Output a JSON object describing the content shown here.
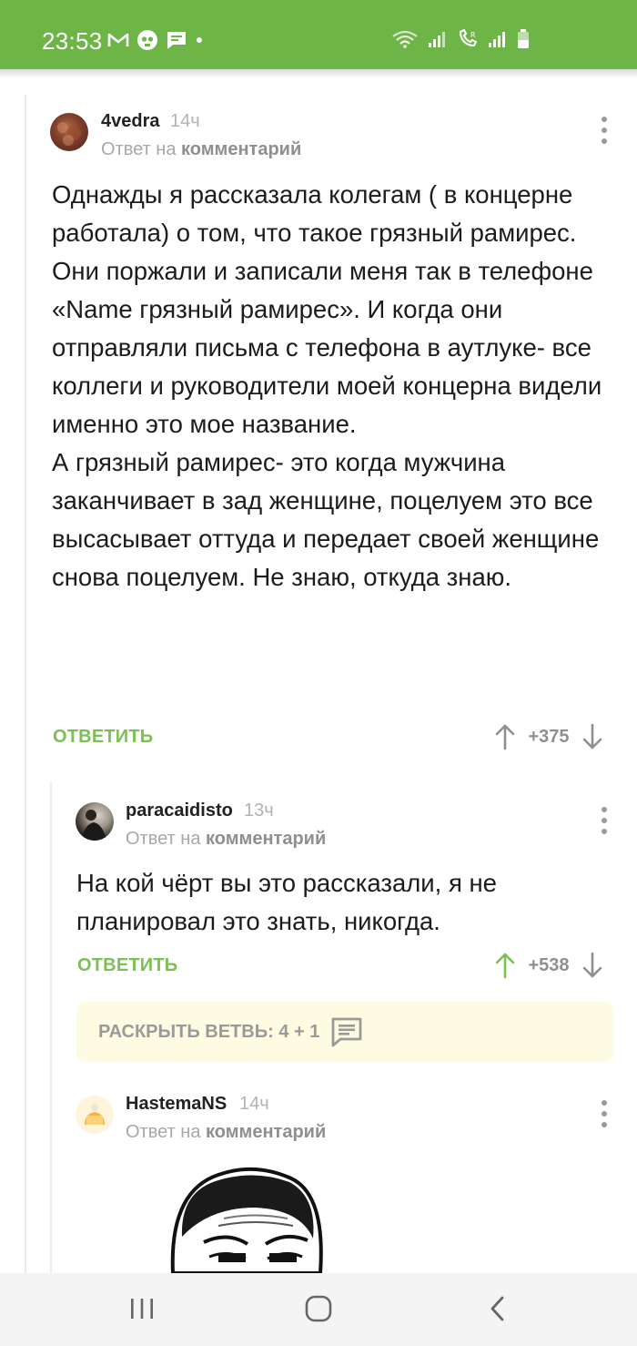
{
  "status_bar": {
    "time": "23:53",
    "background": "#6eb548",
    "left_icons": [
      "gmail-icon",
      "skull-app-icon",
      "message-icon",
      "dot-icon"
    ],
    "right_icons": [
      "wifi-icon",
      "signal-icon",
      "volte-call-icon",
      "roaming-signal-icon",
      "battery-icon"
    ]
  },
  "comments": [
    {
      "author": "4vedra",
      "time": "14ч",
      "reply_prefix": "Ответ на",
      "reply_link": "комментарий",
      "text": "Однажды я рассказала колегам ( в концерне работала) о том, что такое грязный рамирес.\nОни поржали и записали меня так в телефоне «Name грязный рамирес». И когда они отправляли письма с телефона в аутлуке- все коллеги и руководители моей концерна видели именно это мое название.\nА грязный рамирес- это когда мужчина заканчивает в зад женщине, поцелуем это все высасывает оттуда и передает своей женщине снова поцелуем. Не знаю, откуда знаю.",
      "reply_label": "ОТВЕТИТЬ",
      "rating": "+375"
    },
    {
      "author": "paracaidisto",
      "time": "13ч",
      "reply_prefix": "Ответ на",
      "reply_link": "комментарий",
      "text": "На кой чёрт вы это рассказали, я не планировал это знать, никогда.",
      "reply_label": "ОТВЕТИТЬ",
      "rating": "+538"
    },
    {
      "author": "HastemaNS",
      "time": "14ч",
      "reply_prefix": "Ответ на",
      "reply_link": "комментарий"
    }
  ],
  "expand_branch": {
    "label": "РАСКРЫТЬ ВЕТВЬ: 4 + 1"
  },
  "colors": {
    "accent_green": "#7cbf55",
    "upvote_active": "#7cbf55",
    "expand_bg": "#fdfbe1"
  },
  "nav_bar": {
    "buttons": [
      "recent-apps-icon",
      "home-icon",
      "back-icon"
    ]
  }
}
